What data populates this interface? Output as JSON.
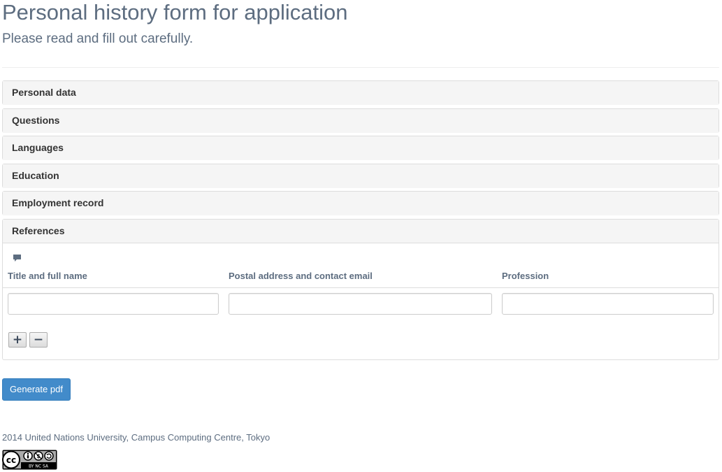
{
  "header": {
    "title": "Personal history form for application",
    "subtitle": "Please read and fill out carefully."
  },
  "sections": [
    {
      "label": "Personal data",
      "expanded": false
    },
    {
      "label": "Questions",
      "expanded": false
    },
    {
      "label": "Languages",
      "expanded": false
    },
    {
      "label": "Education",
      "expanded": false
    },
    {
      "label": "Employment record",
      "expanded": false
    },
    {
      "label": "References",
      "expanded": true
    }
  ],
  "references": {
    "comment_icon": "comment-icon",
    "columns": [
      "Title and full name",
      "Postal address and contact email",
      "Profession"
    ],
    "rows": [
      {
        "title_full_name": "",
        "postal_address_email": "",
        "profession": ""
      }
    ],
    "add_symbol": "+",
    "remove_symbol": "−"
  },
  "actions": {
    "generate_label": "Generate pdf"
  },
  "footer": {
    "text": "2014 United Nations University, Campus Computing Centre, Tokyo",
    "license_badge": "cc-by-nc-sa-icon",
    "license_badge_text": "BY NC SA"
  },
  "colors": {
    "heading_text": "#5d6d80",
    "panel_heading_bg": "#f5f5f5",
    "primary_button": "#428bca"
  }
}
